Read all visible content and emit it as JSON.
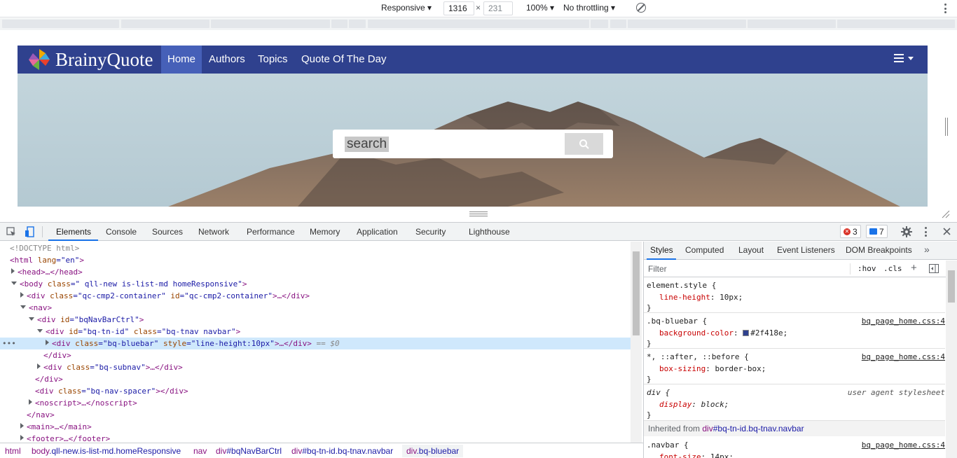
{
  "device_toolbar": {
    "mode": "Responsive",
    "width": "1316",
    "times": "×",
    "height": "231",
    "zoom": "100%",
    "throttle": "No throttling"
  },
  "site": {
    "logo_text": "BrainyQuote",
    "nav": [
      "Home",
      "Authors",
      "Topics",
      "Quote Of The Day"
    ],
    "search_placeholder": "search"
  },
  "devtools": {
    "tabs": [
      "Elements",
      "Console",
      "Sources",
      "Network",
      "Performance",
      "Memory",
      "Application",
      "Security",
      "Lighthouse"
    ],
    "errors": "3",
    "messages": "7"
  },
  "dom": {
    "doctype": "<!DOCTYPE html>",
    "l1_tag": "<html",
    "l1_an": " lang",
    "l1_av": "=\"en\"",
    "l1_end": ">",
    "l2": "<head>…</head>",
    "l3_tag": "<body",
    "l3_an": " class",
    "l3_av": "=\" qll-new is-list-md homeResponsive\"",
    "l3_end": ">",
    "l4_tag": "<div",
    "l4_an1": " class",
    "l4_av1": "=\"qc-cmp2-container\"",
    "l4_an2": " id",
    "l4_av2": "=\"qc-cmp2-container\"",
    "l4_end": ">…</div>",
    "l5": "<nav>",
    "l6_tag": "<div",
    "l6_an": " id",
    "l6_av": "=\"bqNavBarCtrl\"",
    "l6_end": ">",
    "l7_tag": "<div",
    "l7_an1": " id",
    "l7_av1": "=\"bq-tn-id\"",
    "l7_an2": " class",
    "l7_av2": "=\"bq-tnav navbar\"",
    "l7_end": ">",
    "l8_tag": "<div",
    "l8_an1": " class",
    "l8_av1": "=\"bq-bluebar\"",
    "l8_an2": " style",
    "l8_av2": "=\"line-height:10px\"",
    "l8_end": ">…</div>",
    "l8_marker": " == $0",
    "l9": "</div>",
    "l10_tag": "<div",
    "l10_an": " class",
    "l10_av": "=\"bq-subnav\"",
    "l10_end": ">…</div>",
    "l11": "</div>",
    "l12_tag": "<div",
    "l12_an": " class",
    "l12_av": "=\"bq-nav-spacer\"",
    "l12_end": "></div>",
    "l13": "<noscript>…</noscript>",
    "l14": "</nav>",
    "l15": "<main>…</main>",
    "l16": "<footer>…</footer>",
    "dots": "•••"
  },
  "breadcrumbs": [
    {
      "tag": "html",
      "rest": ""
    },
    {
      "tag": "body",
      "rest": ".qll-new.is-list-md.homeResponsive"
    },
    {
      "tag": "nav",
      "rest": ""
    },
    {
      "tag": "div",
      "rest": "#bqNavBarCtrl"
    },
    {
      "tag": "div",
      "rest": "#bq-tn-id.bq-tnav.navbar"
    },
    {
      "tag": "div",
      "rest": ".bq-bluebar"
    }
  ],
  "styles": {
    "tabs": [
      "Styles",
      "Computed",
      "Layout",
      "Event Listeners",
      "DOM Breakpoints"
    ],
    "more": "»",
    "filter": "Filter",
    "hov": ":hov",
    "cls": ".cls",
    "plus": "+",
    "rules": [
      {
        "selector": "element.style {",
        "prop": "line-height",
        "value": "10px;",
        "source": ""
      },
      {
        "selector": ".bq-bluebar {",
        "prop": "background-color",
        "value": "#2f418e;",
        "source": "bq_page_home.css:4"
      },
      {
        "selector": "*, ::after, ::before {",
        "prop": "box-sizing",
        "value": "border-box;",
        "source": "bq_page_home.css:4"
      },
      {
        "selector": "div {",
        "prop": "display",
        "value": "block;",
        "source": "user agent stylesheet"
      }
    ],
    "close_brace": "}",
    "inherited_label": "Inherited from ",
    "inherited_tag": "div",
    "inherited_rest": "#bq-tn-id.bq-tnav.navbar",
    "last_selector": ".navbar {",
    "last_prop": "font-size",
    "last_value": "14px;",
    "last_source": "bq_page_home.css:4"
  },
  "colors": {
    "brand": "#2f418e",
    "accent": "#1a73e8"
  }
}
